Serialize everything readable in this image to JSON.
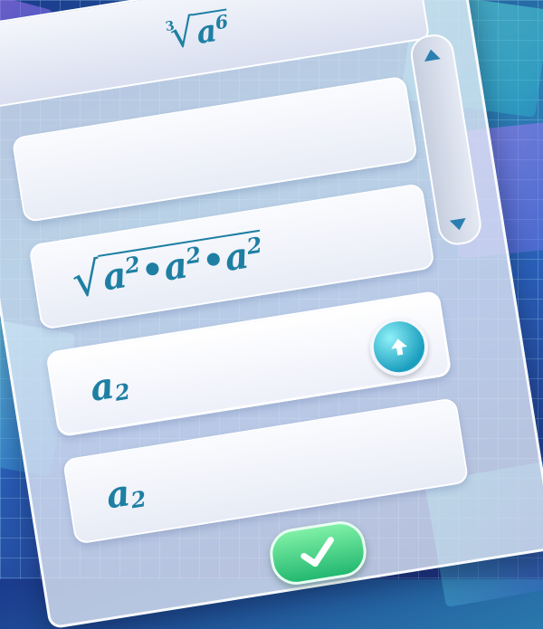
{
  "question": {
    "index": "3",
    "base": "a",
    "exponent": "6"
  },
  "options": [
    {
      "parts": [
        {
          "base": "a",
          "exp": "2"
        },
        {
          "base": "a",
          "exp": "2"
        },
        {
          "base": "a",
          "exp": "2"
        }
      ],
      "separator": "•"
    },
    {
      "base": "a",
      "exp": "2"
    },
    {
      "base": "a",
      "exp": "2"
    }
  ],
  "controls": {
    "scroll_up_icon": "triangle-up-icon",
    "scroll_down_icon": "triangle-down-icon",
    "move_up_icon": "arrow-up-icon",
    "confirm_icon": "checkmark-icon"
  },
  "colors": {
    "math_text": "#1e7fa3",
    "move_up_button": "#1c9fbf",
    "confirm_button": "#23b870"
  }
}
